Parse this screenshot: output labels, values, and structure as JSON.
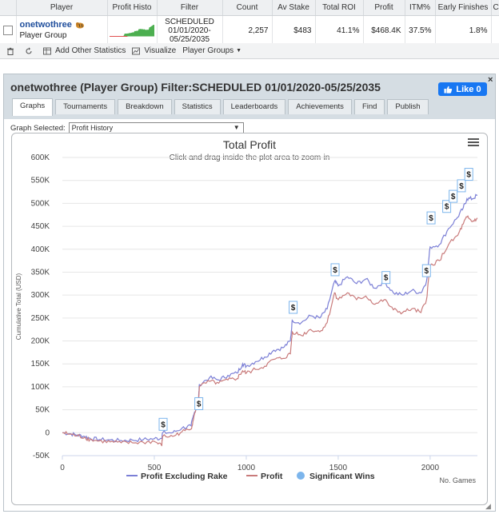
{
  "table": {
    "headers": [
      "Player",
      "Profit Histo",
      "Filter",
      "Count",
      "Av Stake",
      "Total ROI",
      "Profit",
      "ITM%",
      "Early Finishes",
      "C"
    ],
    "row": {
      "player_name": "onetwothree",
      "player_type": "Player Group",
      "filter_line1": "SCHEDULED",
      "filter_line2": "01/01/2020-",
      "filter_line3": "05/25/2035",
      "count": "2,257",
      "av_stake": "$483",
      "total_roi": "41.1%",
      "profit": "$468.4K",
      "itm": "37.5%",
      "early_finishes": "1.8%"
    }
  },
  "toolbar": {
    "add_stats_label": "Add Other Statistics",
    "visualize_label": "Visualize",
    "player_groups_label": "Player Groups"
  },
  "dialog": {
    "title": "onetwothree (Player Group) Filter:SCHEDULED 01/01/2020-05/25/2035",
    "fb_like_label": "Like 0",
    "close_label": "×",
    "tabs": [
      {
        "label": "Graphs"
      },
      {
        "label": "Tournaments"
      },
      {
        "label": "Breakdown"
      },
      {
        "label": "Statistics"
      },
      {
        "label": "Leaderboards"
      },
      {
        "label": "Achievements"
      },
      {
        "label": "Find"
      },
      {
        "label": "Publish"
      }
    ],
    "graph_selected_label": "Graph Selected:",
    "graph_selected_value": "Profit History"
  },
  "colors": {
    "profit_excl_rake": "#7b7fd6",
    "profit": "#c97b7b",
    "significant_wins": "#7cb5ec",
    "histo_green": "#4caf50",
    "histo_red": "#e05050"
  },
  "chart_data": {
    "type": "line",
    "title": "Total Profit",
    "subtitle": "Click and drag inside the plot area to zoom-in",
    "ylabel": "Cumulative Total (USD)",
    "xlabel": "No. Games",
    "xlim": [
      0,
      2257
    ],
    "ylim": [
      -50000,
      600000
    ],
    "x_ticks": [
      0,
      500,
      1000,
      1500,
      2000
    ],
    "y_ticks": [
      -50000,
      0,
      50000,
      100000,
      150000,
      200000,
      250000,
      300000,
      350000,
      400000,
      450000,
      500000,
      550000,
      600000
    ],
    "y_tick_labels": [
      "-50K",
      "0",
      "50K",
      "100K",
      "150K",
      "200K",
      "250K",
      "300K",
      "350K",
      "400K",
      "450K",
      "500K",
      "550K",
      "600K"
    ],
    "legend": [
      "Profit Excluding Rake",
      "Profit",
      "Significant Wins"
    ],
    "legend_position": "bottom",
    "series": [
      {
        "name": "Profit Excluding Rake",
        "x": [
          0,
          40,
          80,
          120,
          150,
          200,
          260,
          320,
          380,
          440,
          500,
          540,
          545,
          600,
          650,
          700,
          715,
          740,
          745,
          800,
          850,
          900,
          950,
          980,
          1000,
          1050,
          1100,
          1150,
          1200,
          1240,
          1250,
          1300,
          1350,
          1400,
          1440,
          1480,
          1500,
          1550,
          1600,
          1650,
          1700,
          1750,
          1800,
          1850,
          1900,
          1950,
          1980,
          2000,
          2050,
          2100,
          2150,
          2180,
          2200,
          2230,
          2257
        ],
        "y": [
          0,
          -2000,
          -5000,
          -8000,
          -12000,
          -15000,
          -16000,
          -17000,
          -16000,
          -15000,
          -13000,
          -12000,
          0,
          0,
          10000,
          15000,
          40000,
          70000,
          105000,
          120000,
          115000,
          125000,
          130000,
          150000,
          145000,
          155000,
          165000,
          180000,
          185000,
          200000,
          245000,
          240000,
          255000,
          250000,
          270000,
          330000,
          320000,
          340000,
          325000,
          335000,
          315000,
          330000,
          305000,
          300000,
          310000,
          305000,
          330000,
          405000,
          410000,
          445000,
          470000,
          490000,
          510000,
          510000,
          518000
        ]
      },
      {
        "name": "Profit",
        "x": [
          0,
          40,
          80,
          120,
          150,
          200,
          260,
          320,
          380,
          440,
          500,
          540,
          545,
          600,
          650,
          700,
          715,
          740,
          745,
          800,
          850,
          900,
          950,
          980,
          1000,
          1050,
          1100,
          1150,
          1200,
          1240,
          1250,
          1300,
          1350,
          1400,
          1440,
          1480,
          1500,
          1550,
          1600,
          1650,
          1700,
          1750,
          1800,
          1850,
          1900,
          1950,
          1980,
          2000,
          2050,
          2100,
          2150,
          2180,
          2200,
          2230,
          2257
        ],
        "y": [
          0,
          -3000,
          -7000,
          -10000,
          -15000,
          -18000,
          -20000,
          -22000,
          -22000,
          -21000,
          -19000,
          -28000,
          -8000,
          -8000,
          2000,
          8000,
          35000,
          65000,
          100000,
          112000,
          108000,
          115000,
          118000,
          135000,
          130000,
          138000,
          145000,
          160000,
          162000,
          172000,
          220000,
          212000,
          225000,
          220000,
          240000,
          305000,
          290000,
          305000,
          290000,
          298000,
          280000,
          290000,
          268000,
          262000,
          270000,
          262000,
          290000,
          365000,
          375000,
          410000,
          430000,
          455000,
          470000,
          460000,
          468000
        ]
      }
    ],
    "significant_wins": [
      {
        "x": 548,
        "y": 0
      },
      {
        "x": 742,
        "y": 45000
      },
      {
        "x": 1255,
        "y": 255000
      },
      {
        "x": 1483,
        "y": 337000
      },
      {
        "x": 1760,
        "y": 320000
      },
      {
        "x": 1980,
        "y": 335000
      },
      {
        "x": 2005,
        "y": 450000
      },
      {
        "x": 2090,
        "y": 475000
      },
      {
        "x": 2125,
        "y": 497000
      },
      {
        "x": 2170,
        "y": 520000
      },
      {
        "x": 2210,
        "y": 545000
      }
    ],
    "marker_symbol": "$"
  }
}
